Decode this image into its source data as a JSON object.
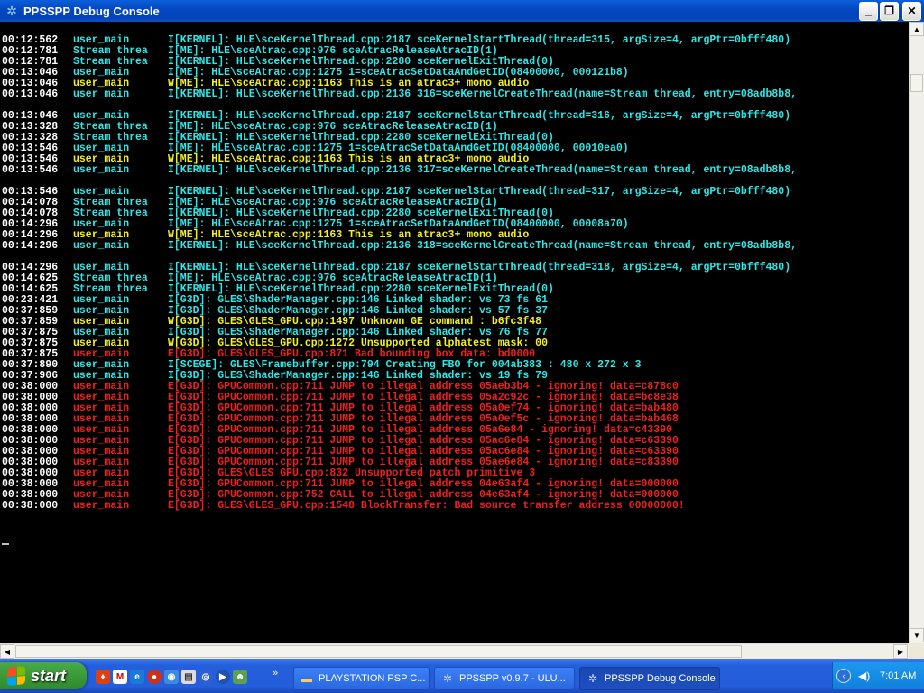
{
  "window": {
    "title": "PPSSPP Debug Console",
    "minimize": "_",
    "restore": "❐",
    "close": "✕"
  },
  "log": [
    {
      "ts": "00:12:562",
      "thread": "user_main",
      "msg": "I[KERNEL]: HLE\\sceKernelThread.cpp:2187 sceKernelStartThread(thread=315, argSize=4, argPtr=0bfff480)",
      "level": "info"
    },
    {
      "ts": "00:12:781",
      "thread": "Stream threa",
      "msg": "I[ME]: HLE\\sceAtrac.cpp:976 sceAtracReleaseAtracID(1)",
      "level": "info"
    },
    {
      "ts": "00:12:781",
      "thread": "Stream threa",
      "msg": "I[KERNEL]: HLE\\sceKernelThread.cpp:2280 sceKernelExitThread(0)",
      "level": "info"
    },
    {
      "ts": "00:13:046",
      "thread": "user_main",
      "msg": "I[ME]: HLE\\sceAtrac.cpp:1275 1=sceAtracSetDataAndGetID(08400000, 000121b8)",
      "level": "info"
    },
    {
      "ts": "00:13:046",
      "thread": "user_main",
      "msg": "W[ME]: HLE\\sceAtrac.cpp:1163 This is an atrac3+ mono audio",
      "level": "warn"
    },
    {
      "ts": "00:13:046",
      "thread": "user_main",
      "msg": "I[KERNEL]: HLE\\sceKernelThread.cpp:2136 316=sceKernelCreateThread(name=Stream thread, entry=08adb8b8,",
      "level": "info"
    },
    {
      "ts": "",
      "thread": "",
      "msg": "",
      "level": "info"
    },
    {
      "ts": "00:13:046",
      "thread": "user_main",
      "msg": "I[KERNEL]: HLE\\sceKernelThread.cpp:2187 sceKernelStartThread(thread=316, argSize=4, argPtr=0bfff480)",
      "level": "info"
    },
    {
      "ts": "00:13:328",
      "thread": "Stream threa",
      "msg": "I[ME]: HLE\\sceAtrac.cpp:976 sceAtracReleaseAtracID(1)",
      "level": "info"
    },
    {
      "ts": "00:13:328",
      "thread": "Stream threa",
      "msg": "I[KERNEL]: HLE\\sceKernelThread.cpp:2280 sceKernelExitThread(0)",
      "level": "info"
    },
    {
      "ts": "00:13:546",
      "thread": "user_main",
      "msg": "I[ME]: HLE\\sceAtrac.cpp:1275 1=sceAtracSetDataAndGetID(08400000, 00010ea0)",
      "level": "info"
    },
    {
      "ts": "00:13:546",
      "thread": "user_main",
      "msg": "W[ME]: HLE\\sceAtrac.cpp:1163 This is an atrac3+ mono audio",
      "level": "warn"
    },
    {
      "ts": "00:13:546",
      "thread": "user_main",
      "msg": "I[KERNEL]: HLE\\sceKernelThread.cpp:2136 317=sceKernelCreateThread(name=Stream thread, entry=08adb8b8,",
      "level": "info"
    },
    {
      "ts": "",
      "thread": "",
      "msg": "",
      "level": "info"
    },
    {
      "ts": "00:13:546",
      "thread": "user_main",
      "msg": "I[KERNEL]: HLE\\sceKernelThread.cpp:2187 sceKernelStartThread(thread=317, argSize=4, argPtr=0bfff480)",
      "level": "info"
    },
    {
      "ts": "00:14:078",
      "thread": "Stream threa",
      "msg": "I[ME]: HLE\\sceAtrac.cpp:976 sceAtracReleaseAtracID(1)",
      "level": "info"
    },
    {
      "ts": "00:14:078",
      "thread": "Stream threa",
      "msg": "I[KERNEL]: HLE\\sceKernelThread.cpp:2280 sceKernelExitThread(0)",
      "level": "info"
    },
    {
      "ts": "00:14:296",
      "thread": "user_main",
      "msg": "I[ME]: HLE\\sceAtrac.cpp:1275 1=sceAtracSetDataAndGetID(08400000, 00008a70)",
      "level": "info"
    },
    {
      "ts": "00:14:296",
      "thread": "user_main",
      "msg": "W[ME]: HLE\\sceAtrac.cpp:1163 This is an atrac3+ mono audio",
      "level": "warn"
    },
    {
      "ts": "00:14:296",
      "thread": "user_main",
      "msg": "I[KERNEL]: HLE\\sceKernelThread.cpp:2136 318=sceKernelCreateThread(name=Stream thread, entry=08adb8b8,",
      "level": "info"
    },
    {
      "ts": "",
      "thread": "",
      "msg": "",
      "level": "info"
    },
    {
      "ts": "00:14:296",
      "thread": "user_main",
      "msg": "I[KERNEL]: HLE\\sceKernelThread.cpp:2187 sceKernelStartThread(thread=318, argSize=4, argPtr=0bfff480)",
      "level": "info"
    },
    {
      "ts": "00:14:625",
      "thread": "Stream threa",
      "msg": "I[ME]: HLE\\sceAtrac.cpp:976 sceAtracReleaseAtracID(1)",
      "level": "info"
    },
    {
      "ts": "00:14:625",
      "thread": "Stream threa",
      "msg": "I[KERNEL]: HLE\\sceKernelThread.cpp:2280 sceKernelExitThread(0)",
      "level": "info"
    },
    {
      "ts": "00:23:421",
      "thread": "user_main",
      "msg": "I[G3D]: GLES\\ShaderManager.cpp:146 Linked shader: vs 73 fs 61",
      "level": "info"
    },
    {
      "ts": "00:37:859",
      "thread": "user_main",
      "msg": "I[G3D]: GLES\\ShaderManager.cpp:146 Linked shader: vs 57 fs 37",
      "level": "info"
    },
    {
      "ts": "00:37:859",
      "thread": "user_main",
      "msg": "W[G3D]: GLES\\GLES_GPU.cpp:1497 Unknown GE command : b6fc3f48",
      "level": "warn"
    },
    {
      "ts": "00:37:875",
      "thread": "user_main",
      "msg": "I[G3D]: GLES\\ShaderManager.cpp:146 Linked shader: vs 76 fs 77",
      "level": "info"
    },
    {
      "ts": "00:37:875",
      "thread": "user_main",
      "msg": "W[G3D]: GLES\\GLES_GPU.cpp:1272 Unsupported alphatest mask: 00",
      "level": "warn"
    },
    {
      "ts": "00:37:875",
      "thread": "user_main",
      "msg": "E[G3D]: GLES\\GLES_GPU.cpp:871 Bad bounding box data: bd0000",
      "level": "error"
    },
    {
      "ts": "00:37:890",
      "thread": "user_main",
      "msg": "I[SCEGE]: GLES\\Framebuffer.cpp:794 Creating FBO for 004ab383 : 480 x 272 x 3",
      "level": "info"
    },
    {
      "ts": "00:37:906",
      "thread": "user_main",
      "msg": "I[G3D]: GLES\\ShaderManager.cpp:146 Linked shader: vs 19 fs 79",
      "level": "info"
    },
    {
      "ts": "00:38:000",
      "thread": "user_main",
      "msg": "E[G3D]: GPUCommon.cpp:711 JUMP to illegal address 05aeb3b4 - ignoring! data=c878c0",
      "level": "error"
    },
    {
      "ts": "00:38:000",
      "thread": "user_main",
      "msg": "E[G3D]: GPUCommon.cpp:711 JUMP to illegal address 05a2c92c - ignoring! data=bc8e38",
      "level": "error"
    },
    {
      "ts": "00:38:000",
      "thread": "user_main",
      "msg": "E[G3D]: GPUCommon.cpp:711 JUMP to illegal address 05a0ef74 - ignoring! data=bab480",
      "level": "error"
    },
    {
      "ts": "00:38:000",
      "thread": "user_main",
      "msg": "E[G3D]: GPUCommon.cpp:711 JUMP to illegal address 05a0ef5c - ignoring! data=bab468",
      "level": "error"
    },
    {
      "ts": "00:38:000",
      "thread": "user_main",
      "msg": "E[G3D]: GPUCommon.cpp:711 JUMP to illegal address 05a6e84 - ignoring! data=c43390",
      "level": "error"
    },
    {
      "ts": "00:38:000",
      "thread": "user_main",
      "msg": "E[G3D]: GPUCommon.cpp:711 JUMP to illegal address 05ac6e84 - ignoring! data=c63390",
      "level": "error"
    },
    {
      "ts": "00:38:000",
      "thread": "user_main",
      "msg": "E[G3D]: GPUCommon.cpp:711 JUMP to illegal address 05ac6e84 - ignoring! data=c63390",
      "level": "error"
    },
    {
      "ts": "00:38:000",
      "thread": "user_main",
      "msg": "E[G3D]: GPUCommon.cpp:711 JUMP to illegal address 05ae6e84 - ignoring! data=c83390",
      "level": "error"
    },
    {
      "ts": "00:38:000",
      "thread": "user_main",
      "msg": "E[G3D]: GLES\\GLES_GPU.cpp:832 Unsupported patch primitive 3",
      "level": "error"
    },
    {
      "ts": "00:38:000",
      "thread": "user_main",
      "msg": "E[G3D]: GPUCommon.cpp:711 JUMP to illegal address 04e63af4 - ignoring! data=000000",
      "level": "error"
    },
    {
      "ts": "00:38:000",
      "thread": "user_main",
      "msg": "E[G3D]: GPUCommon.cpp:752 CALL to illegal address 04e63af4 - ignoring! data=000000",
      "level": "error"
    },
    {
      "ts": "00:38:000",
      "thread": "user_main",
      "msg": "E[G3D]: GLES\\GLES_GPU.cpp:1548 BlockTransfer: Bad source transfer address 00000000!",
      "level": "error"
    }
  ],
  "scrollbar": {
    "up": "▲",
    "down": "▼",
    "left": "◀",
    "right": "▶"
  },
  "taskbar": {
    "start_label": "start",
    "chevron": "»",
    "tasks": [
      {
        "label": "PLAYSTATION PSP C...",
        "icon": "folder-icon",
        "active": false
      },
      {
        "label": "PPSSPP v0.9.7 - ULU...",
        "icon": "ppsspp-icon",
        "active": false
      },
      {
        "label": "PPSSPP Debug Console",
        "icon": "ppsspp-icon",
        "active": true
      }
    ],
    "tray_arrow": "‹",
    "clock": "7:01 AM"
  },
  "colors": {
    "info": "#2ee6e6",
    "warn": "#f0f020",
    "error": "#f02020",
    "timestamp": "#ffffff"
  }
}
